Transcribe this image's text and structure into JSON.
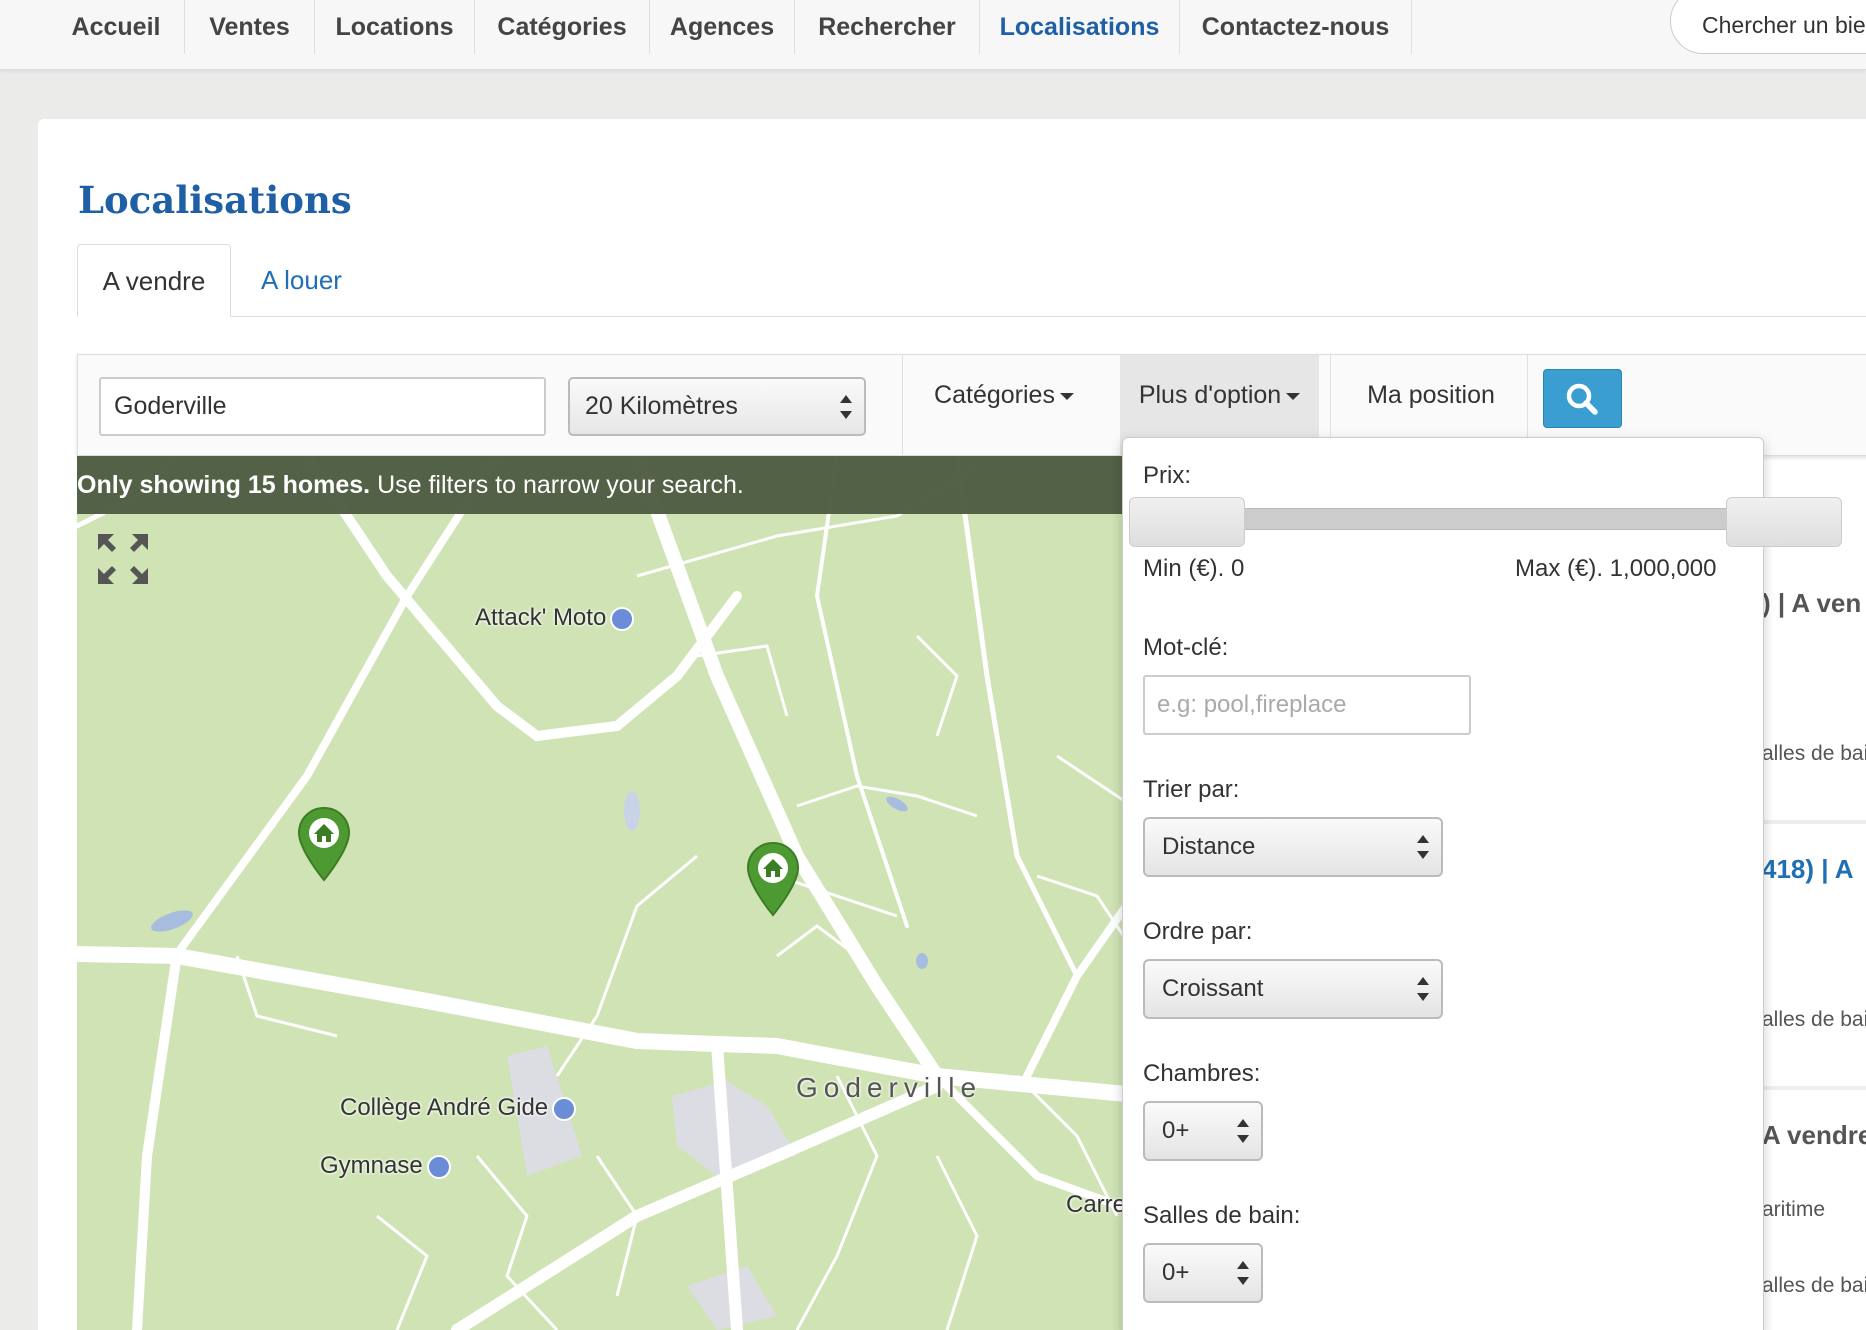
{
  "nav": {
    "items": [
      "Accueil",
      "Ventes",
      "Locations",
      "Catégories",
      "Agences",
      "Rechercher",
      "Localisations",
      "Contactez-nous"
    ],
    "active_index": 6,
    "search_placeholder": "Chercher un bie"
  },
  "page": {
    "title": "Localisations",
    "tabs": [
      "A vendre",
      "A louer"
    ]
  },
  "filters": {
    "location_value": "Goderville",
    "distance_value": "20 Kilomètres",
    "categories_label": "Catégories",
    "more_options_label": "Plus d'option",
    "my_position_label": "Ma position"
  },
  "map": {
    "banner_bold": "Only showing 15 homes.",
    "banner_rest": " Use filters to narrow your search.",
    "labels": {
      "attack_moto": "Attack' Moto",
      "college": "Collège André Gide",
      "gymnase": "Gymnase",
      "town": "Goderville",
      "carre": "Carre"
    }
  },
  "dropdown": {
    "price_label": "Prix:",
    "price_min": "Min (€). 0",
    "price_max": "Max (€). 1,000,000",
    "keyword_label": "Mot-clé:",
    "keyword_placeholder": "e.g: pool,fireplace",
    "sort_label": "Trier par:",
    "sort_value": "Distance",
    "order_label": "Ordre par:",
    "order_value": "Croissant",
    "bedrooms_label": "Chambres:",
    "bedrooms_value": "0+",
    "bathrooms_label": "Salles de bain:",
    "bathrooms_value": "0+"
  },
  "listings": {
    "item1_title": ") | A ven",
    "item1_sub": "alles de bai",
    "item2_title": "418) | A",
    "item2_sub": "alles de bai",
    "item3_title": "A vendre",
    "item3_sub1": "aritime",
    "item3_sub2": "alles de bai"
  },
  "colors": {
    "link_blue": "#1f5fa6",
    "search_button": "#3a9fd0",
    "map_green": "#cfe3b4",
    "marker_green": "#4e9a32",
    "banner": "#4e5c42"
  }
}
